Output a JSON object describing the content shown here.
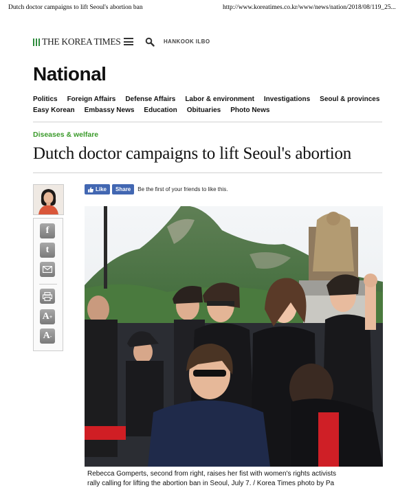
{
  "print_header": {
    "title": "Dutch doctor campaigns to lift Seoul's abortion ban",
    "url": "http://www.koreatimes.co.kr/www/news/nation/2018/08/119_25..."
  },
  "masthead": {
    "logo_text": "THE KOREA TIMES",
    "menu_icon": "hamburger-icon",
    "search_icon": "search-icon",
    "hankook_label": "HANKOOK ILBO"
  },
  "section": {
    "title": "National",
    "nav_row1": [
      "Politics",
      "Foreign Affairs",
      "Defense Affairs",
      "Labor & environment",
      "Investigations",
      "Seoul & provinces"
    ],
    "nav_row2": [
      "Easy Korean",
      "Embassy News",
      "Education",
      "Obituaries",
      "Photo News"
    ]
  },
  "article": {
    "category": "Diseases & welfare",
    "headline": "Dutch doctor campaigns to lift Seoul's abortion",
    "facebook": {
      "like_label": "Like",
      "share_label": "Share",
      "social_text": "Be the first of your friends to like this."
    },
    "caption_line1": "Rebecca Gomperts, second from right, raises her fist with women's rights activists",
    "caption_line2": "rally calling for lifting the abortion ban in Seoul, July 7. / Korea Times photo by Pa"
  },
  "share_tools": {
    "icons": [
      "facebook-icon",
      "twitter-icon",
      "email-icon",
      "print-icon",
      "font-increase-icon",
      "font-decrease-icon"
    ]
  },
  "colors": {
    "logo_green": "#2e8b3c",
    "category_green": "#3a9a2a",
    "facebook_blue": "#4267b2"
  }
}
